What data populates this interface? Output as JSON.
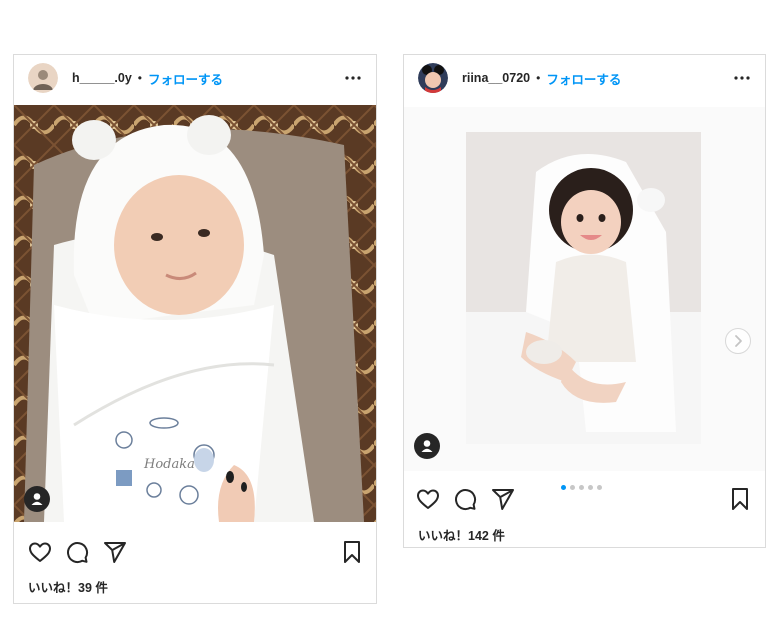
{
  "posts": [
    {
      "username": "h_____.0y",
      "separator": "•",
      "follow_label": "フォローする",
      "likes_text": "いいね！39 件",
      "embroidery_text": "Hodaka"
    },
    {
      "username": "riina__0720",
      "separator": "•",
      "follow_label": "フォローする",
      "likes_text": "いいね！142 件",
      "carousel": {
        "count": 5,
        "active_index": 0
      }
    }
  ],
  "icons": [
    "more-icon",
    "heart-icon",
    "comment-icon",
    "share-icon",
    "bookmark-icon",
    "user-tag-icon",
    "chevron-right-icon"
  ],
  "colors": {
    "follow_blue": "#0095f6",
    "text": "#262626",
    "border": "#dbdbdb"
  }
}
